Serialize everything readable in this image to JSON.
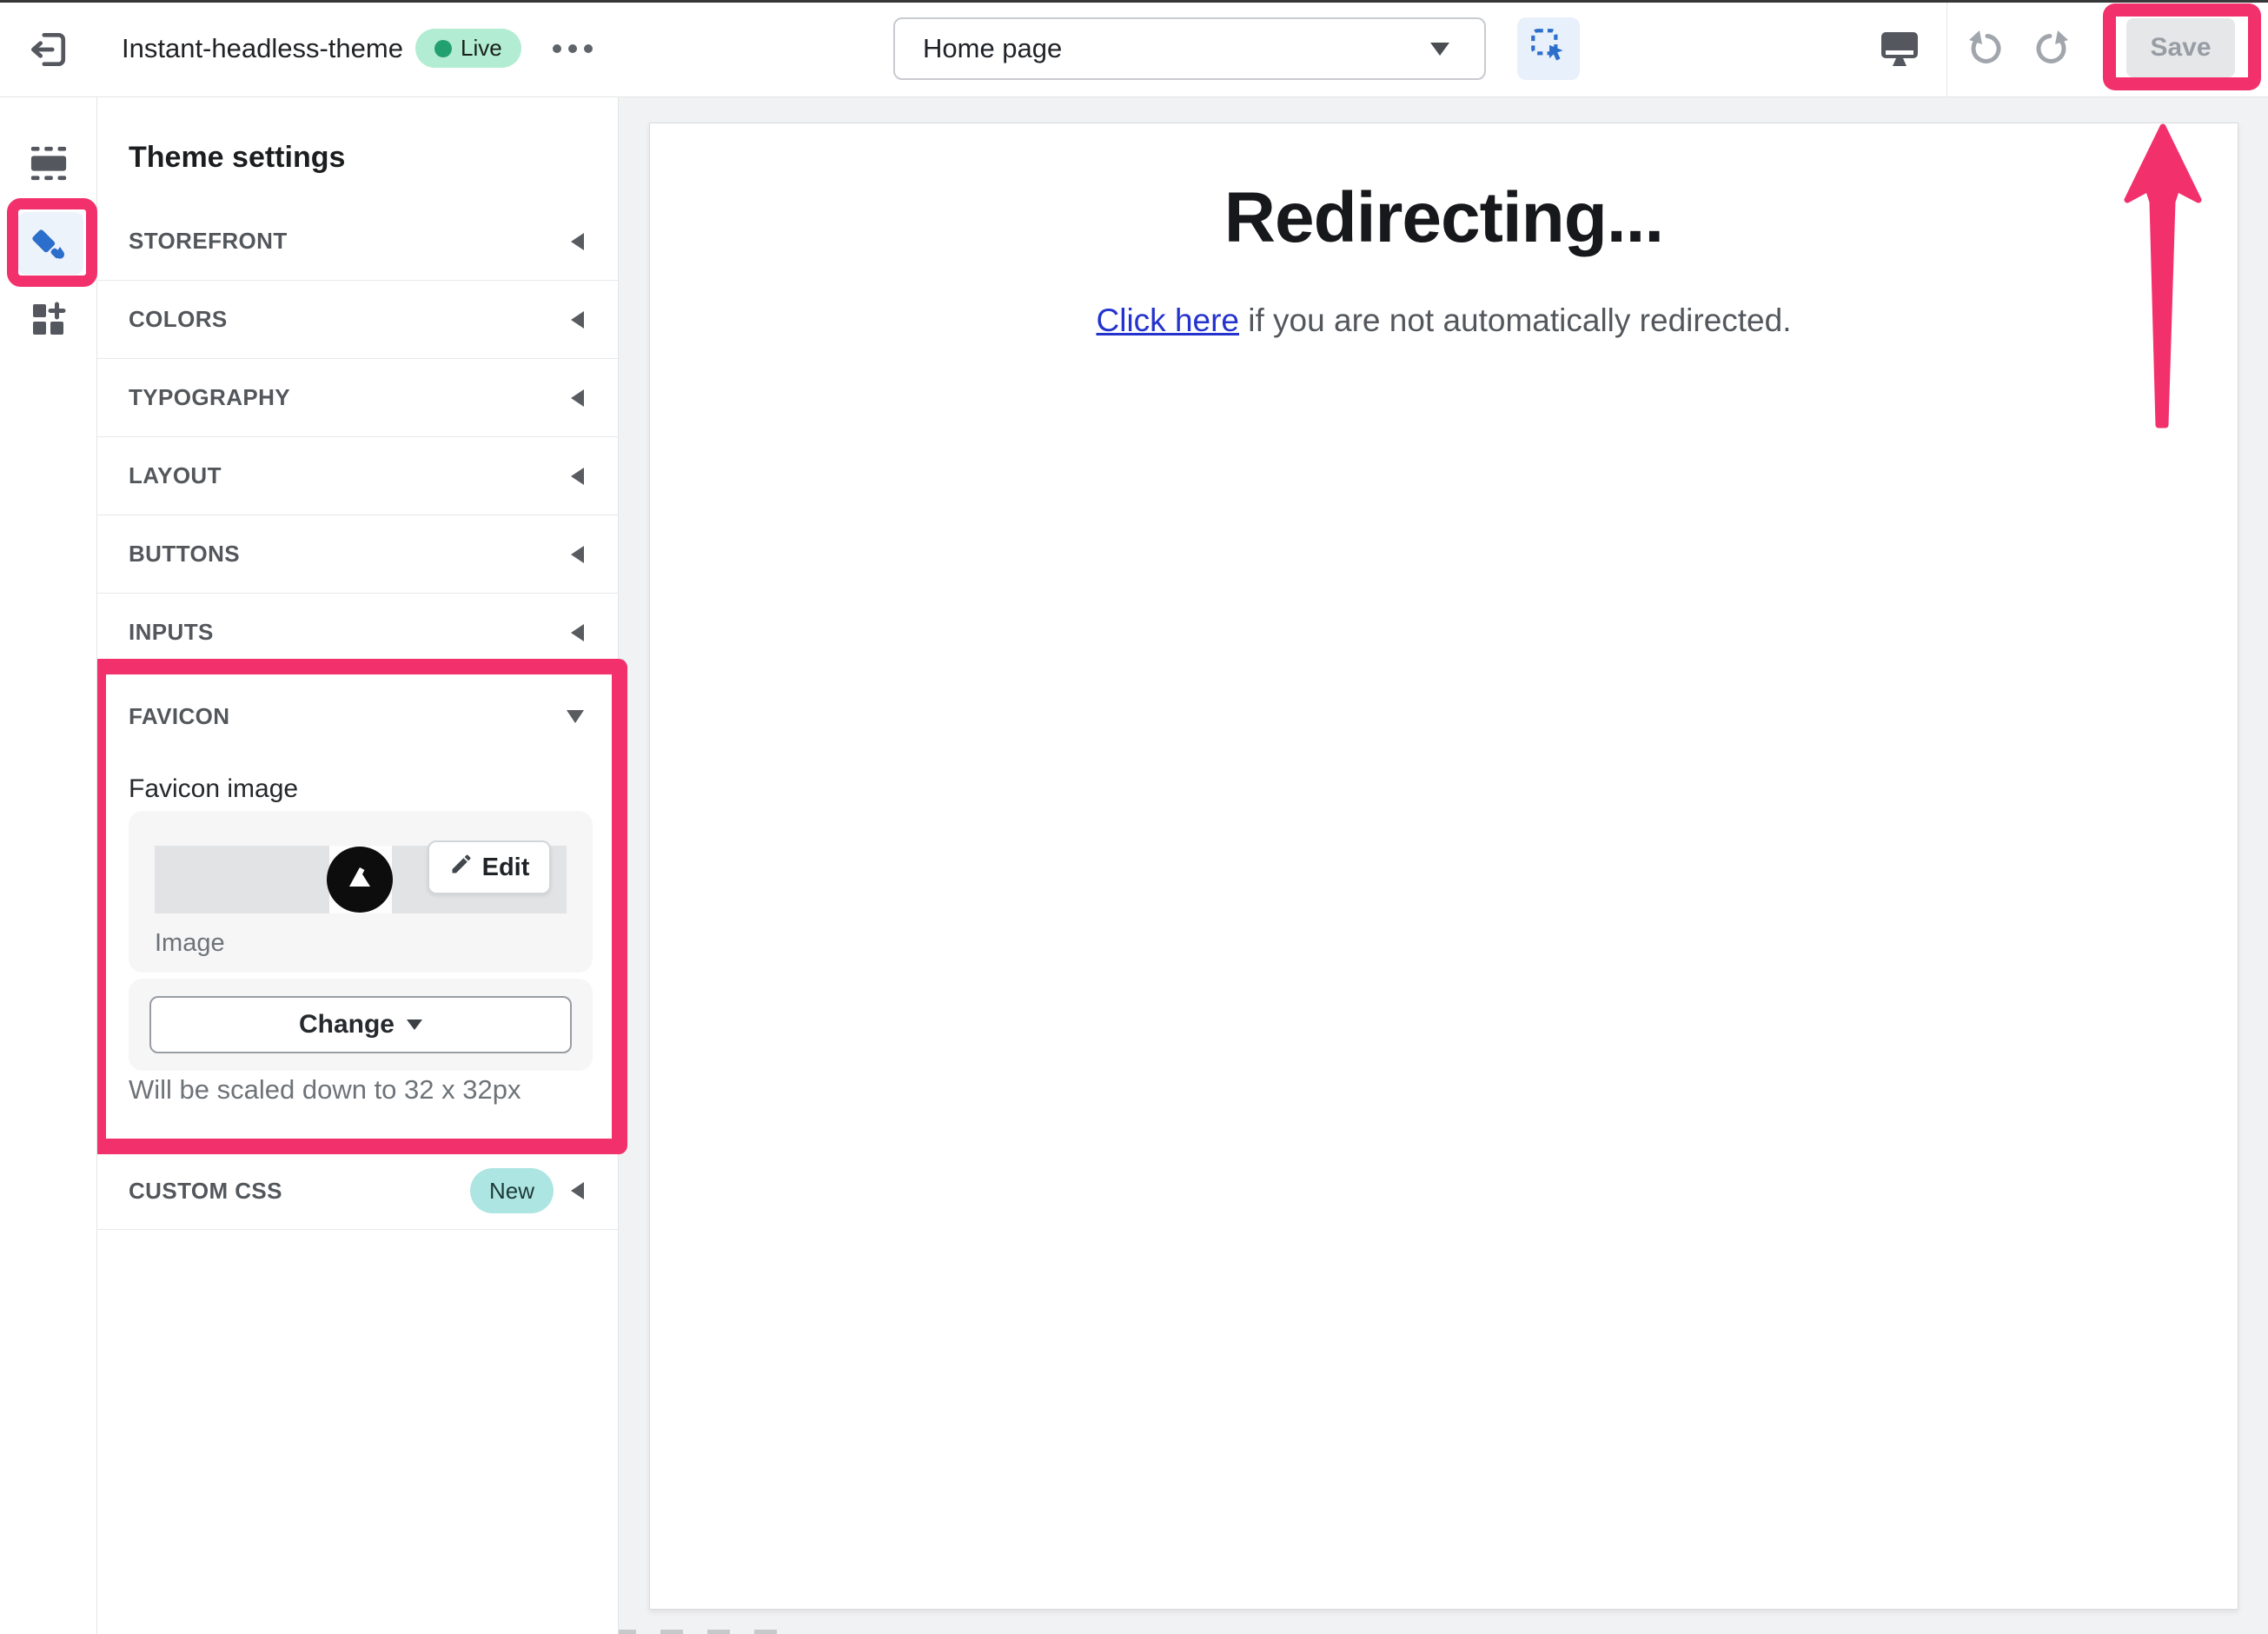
{
  "header": {
    "title": "Instant-headless-theme",
    "live_badge": "Live",
    "page_selector": {
      "value": "Home page"
    },
    "save_label": "Save"
  },
  "rail": {
    "items": [
      {
        "name": "sections",
        "selected": false
      },
      {
        "name": "theme-settings",
        "selected": true
      },
      {
        "name": "apps",
        "selected": false
      }
    ]
  },
  "panel": {
    "heading": "Theme settings",
    "sections": [
      {
        "label": "STOREFRONT",
        "state": "collapsed"
      },
      {
        "label": "COLORS",
        "state": "collapsed"
      },
      {
        "label": "TYPOGRAPHY",
        "state": "collapsed"
      },
      {
        "label": "LAYOUT",
        "state": "collapsed"
      },
      {
        "label": "BUTTONS",
        "state": "collapsed"
      },
      {
        "label": "INPUTS",
        "state": "collapsed"
      },
      {
        "label": "FAVICON",
        "state": "expanded"
      }
    ],
    "favicon": {
      "field_label": "Favicon image",
      "image_caption": "Image",
      "edit_label": "Edit",
      "change_label": "Change",
      "helper_text": "Will be scaled down to 32 x 32px"
    },
    "custom_css": {
      "label": "CUSTOM CSS",
      "badge": "New",
      "state": "collapsed"
    }
  },
  "canvas": {
    "heading": "Redirecting...",
    "link_text": "Click here",
    "after_link_text": " if you are not automatically redirected."
  },
  "icons": [
    "exit-icon",
    "overflow-menu-icon",
    "dropdown-caret-icon",
    "select-element-icon",
    "desktop-preview-icon",
    "undo-icon",
    "redo-icon",
    "sections-icon",
    "paint-brush-icon",
    "apps-icon",
    "collapsed-caret-icon",
    "expanded-caret-icon",
    "pencil-icon",
    "favicon-logo-icon",
    "annotation-arrow"
  ],
  "colors": {
    "annotation_pink": "#F2306B",
    "accent_blue": "#2C6ECB",
    "live_badge_bg": "#B2ECD2",
    "live_dot_green": "#23A06F",
    "new_badge_bg": "#ACE5E1",
    "link_blue": "#2433CD",
    "disabled_save_bg": "#E6E7E9",
    "panel_border": "#E4E5E7"
  }
}
